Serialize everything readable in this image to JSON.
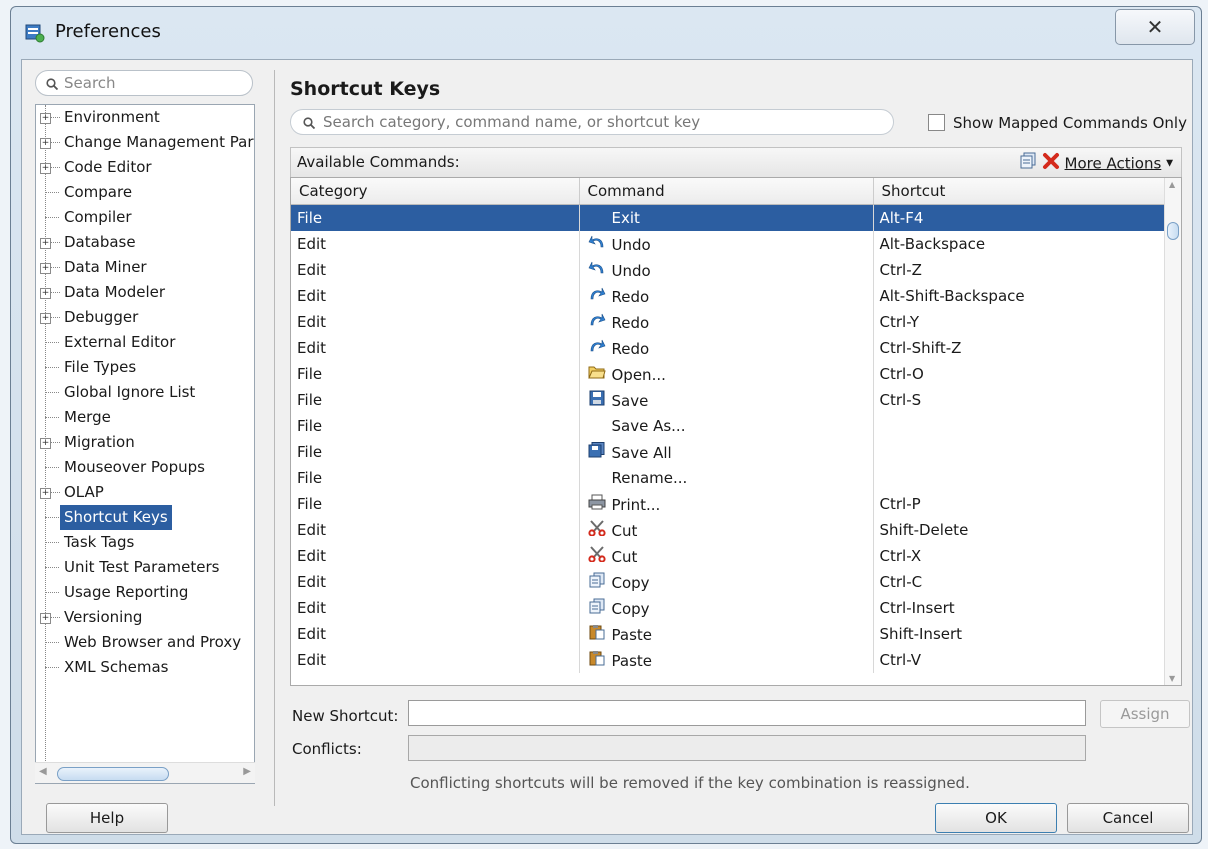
{
  "window": {
    "title": "Preferences",
    "close_glyph": "✕"
  },
  "left": {
    "search_placeholder": "Search",
    "tree": [
      {
        "label": "Environment",
        "expandable": true
      },
      {
        "label": "Change Management Par",
        "expandable": true
      },
      {
        "label": "Code Editor",
        "expandable": true
      },
      {
        "label": "Compare",
        "expandable": false
      },
      {
        "label": "Compiler",
        "expandable": false
      },
      {
        "label": "Database",
        "expandable": true
      },
      {
        "label": "Data Miner",
        "expandable": true
      },
      {
        "label": "Data Modeler",
        "expandable": true
      },
      {
        "label": "Debugger",
        "expandable": true
      },
      {
        "label": "External Editor",
        "expandable": false
      },
      {
        "label": "File Types",
        "expandable": false
      },
      {
        "label": "Global Ignore List",
        "expandable": false
      },
      {
        "label": "Merge",
        "expandable": false
      },
      {
        "label": "Migration",
        "expandable": true
      },
      {
        "label": "Mouseover Popups",
        "expandable": false
      },
      {
        "label": "OLAP",
        "expandable": true
      },
      {
        "label": "Shortcut Keys",
        "expandable": false,
        "selected": true
      },
      {
        "label": "Task Tags",
        "expandable": false
      },
      {
        "label": "Unit Test Parameters",
        "expandable": false
      },
      {
        "label": "Usage Reporting",
        "expandable": false
      },
      {
        "label": "Versioning",
        "expandable": true
      },
      {
        "label": "Web Browser and Proxy",
        "expandable": false
      },
      {
        "label": "XML Schemas",
        "expandable": false
      }
    ]
  },
  "main": {
    "heading": "Shortcut Keys",
    "search_placeholder": "Search category, command name, or shortcut key",
    "show_mapped_label": "Show Mapped Commands Only",
    "available_label": "Available Commands:",
    "more_actions_label": "More Actions",
    "columns": [
      "Category",
      "Command",
      "Shortcut"
    ],
    "rows": [
      {
        "category": "File",
        "command": "Exit",
        "shortcut": "Alt-F4",
        "icon": "none",
        "selected": true
      },
      {
        "category": "Edit",
        "command": "Undo",
        "shortcut": "Alt-Backspace",
        "icon": "undo-icon"
      },
      {
        "category": "Edit",
        "command": "Undo",
        "shortcut": "Ctrl-Z",
        "icon": "undo-icon"
      },
      {
        "category": "Edit",
        "command": "Redo",
        "shortcut": "Alt-Shift-Backspace",
        "icon": "redo-icon"
      },
      {
        "category": "Edit",
        "command": "Redo",
        "shortcut": "Ctrl-Y",
        "icon": "redo-icon"
      },
      {
        "category": "Edit",
        "command": "Redo",
        "shortcut": "Ctrl-Shift-Z",
        "icon": "redo-icon"
      },
      {
        "category": "File",
        "command": "Open...",
        "shortcut": "Ctrl-O",
        "icon": "folder-icon"
      },
      {
        "category": "File",
        "command": "Save",
        "shortcut": "Ctrl-S",
        "icon": "save-icon"
      },
      {
        "category": "File",
        "command": "Save As...",
        "shortcut": "",
        "icon": "none"
      },
      {
        "category": "File",
        "command": "Save All",
        "shortcut": "",
        "icon": "save-all-icon"
      },
      {
        "category": "File",
        "command": "Rename...",
        "shortcut": "",
        "icon": "none"
      },
      {
        "category": "File",
        "command": "Print...",
        "shortcut": "Ctrl-P",
        "icon": "print-icon"
      },
      {
        "category": "Edit",
        "command": "Cut",
        "shortcut": "Shift-Delete",
        "icon": "cut-icon"
      },
      {
        "category": "Edit",
        "command": "Cut",
        "shortcut": "Ctrl-X",
        "icon": "cut-icon"
      },
      {
        "category": "Edit",
        "command": "Copy",
        "shortcut": "Ctrl-C",
        "icon": "copy-icon"
      },
      {
        "category": "Edit",
        "command": "Copy",
        "shortcut": "Ctrl-Insert",
        "icon": "copy-icon"
      },
      {
        "category": "Edit",
        "command": "Paste",
        "shortcut": "Shift-Insert",
        "icon": "paste-icon"
      },
      {
        "category": "Edit",
        "command": "Paste",
        "shortcut": "Ctrl-V",
        "icon": "paste-icon"
      }
    ],
    "new_shortcut_label": "New Shortcut:",
    "new_shortcut_value": "",
    "assign_label": "Assign",
    "conflicts_label": "Conflicts:",
    "conflicts_value": "",
    "hint": "Conflicting shortcuts will be removed if the key combination is reassigned."
  },
  "footer": {
    "help_label": "Help",
    "ok_label": "OK",
    "cancel_label": "Cancel"
  },
  "colors": {
    "selection": "#2c5ea1",
    "window_border": "#6b7f93"
  }
}
